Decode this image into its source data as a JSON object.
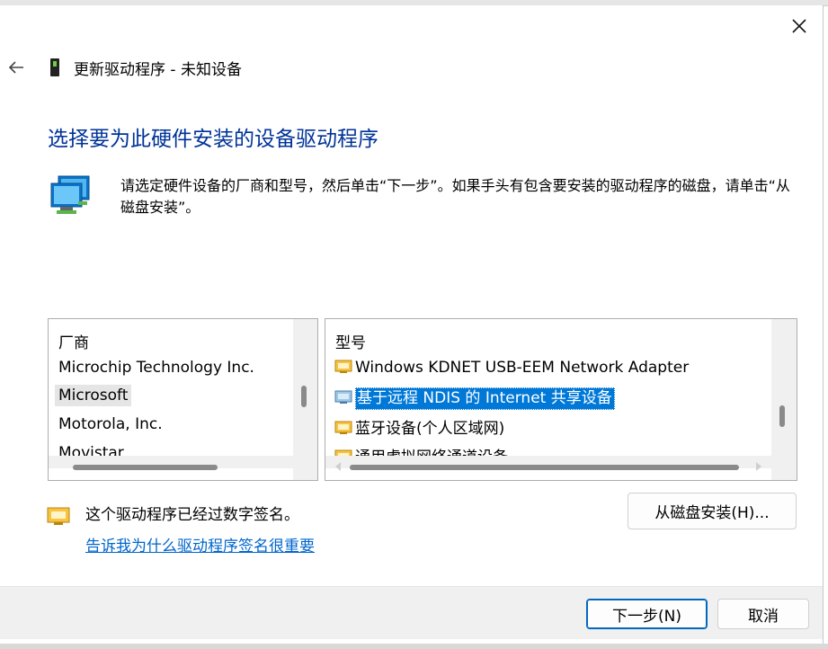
{
  "window": {
    "title": "更新驱动程序 - 未知设备",
    "close_icon": "close-icon",
    "back_icon": "back-arrow-icon"
  },
  "main": {
    "heading": "选择要为此硬件安装的设备驱动程序",
    "description": "请选定硬件设备的厂商和型号，然后单击“下一步”。如果手头有包含要安装的驱动程序的磁盘，请单击“从磁盘安装”。"
  },
  "manufacturer_list": {
    "header": "厂商",
    "items": [
      "Microchip Technology Inc.",
      "Microsoft",
      "Motorola, Inc.",
      "Movistar"
    ],
    "selected": "Microsoft"
  },
  "model_list": {
    "header": "型号",
    "items": [
      "Windows KDNET USB-EEM Network Adapter",
      "基于远程 NDIS 的 Internet 共享设备",
      "蓝牙设备(个人区域网)",
      "通用虚拟网络通道设备"
    ],
    "selected": "基于远程 NDIS 的 Internet 共享设备"
  },
  "signature": {
    "text": "这个驱动程序已经过数字签名。",
    "link": "告诉我为什么驱动程序签名很重要"
  },
  "buttons": {
    "have_disk": "从磁盘安装(H)...",
    "next": "下一步(N)",
    "cancel": "取消"
  },
  "colors": {
    "heading": "#003399",
    "link": "#0066cc",
    "selection": "#0078d7"
  }
}
